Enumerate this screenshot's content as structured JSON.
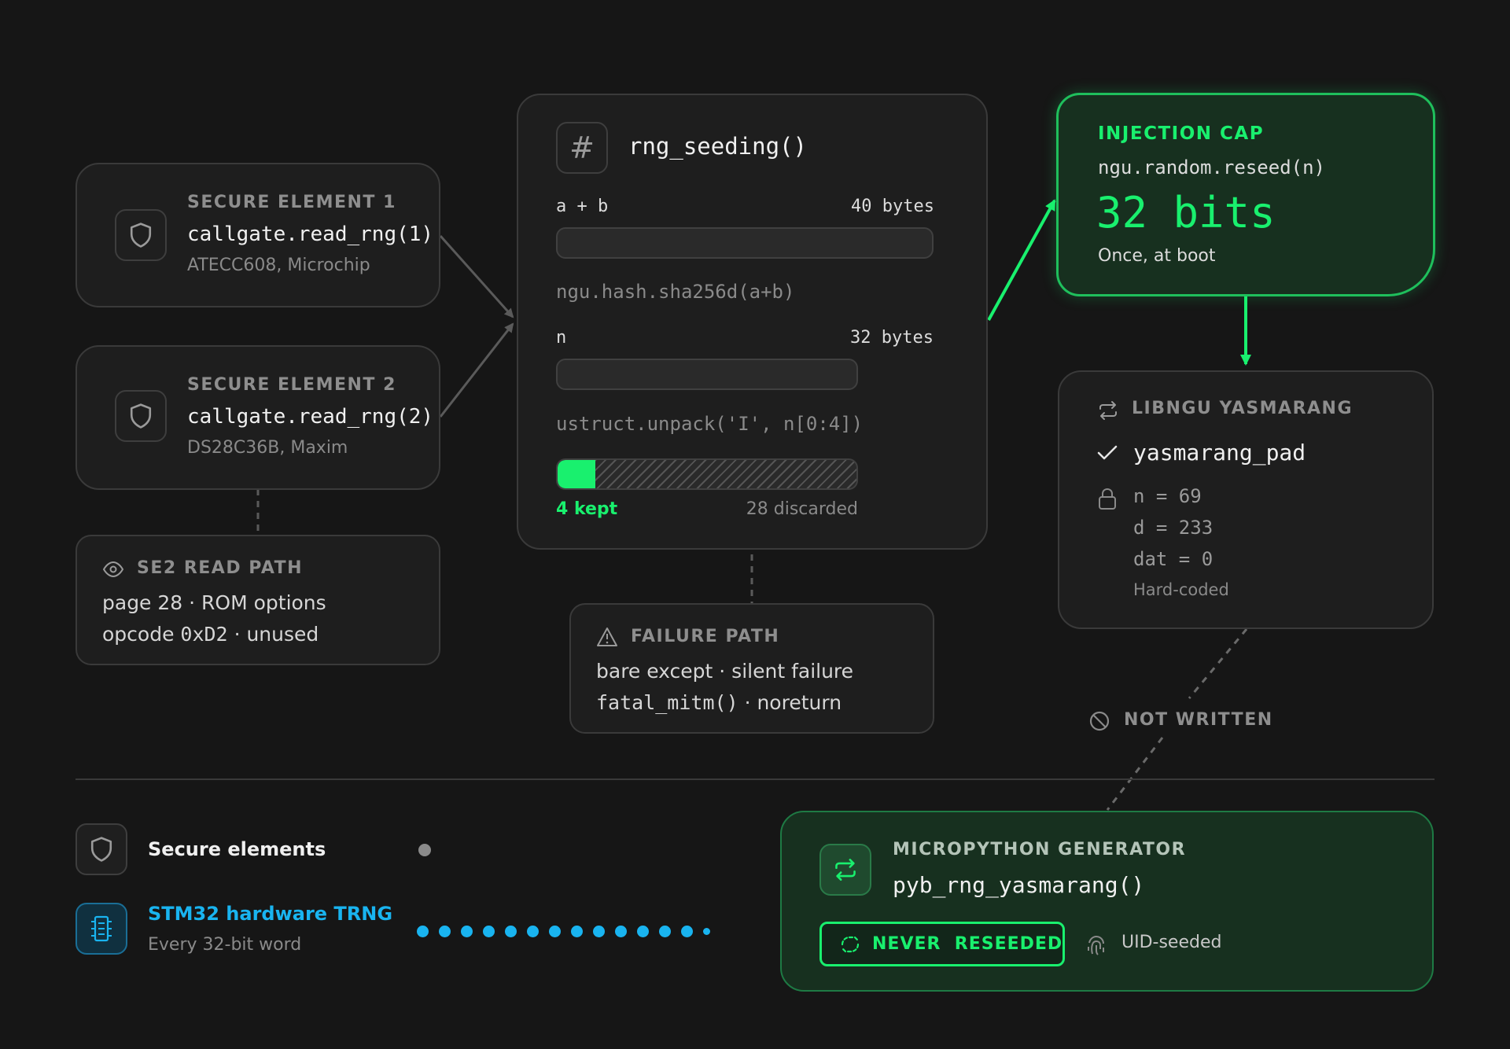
{
  "se1": {
    "label": "SECURE ELEMENT 1",
    "call": "callgate.read_rng(1)",
    "chip": "ATECC608, Microchip",
    "icon": "shield-icon"
  },
  "se2": {
    "label": "SECURE ELEMENT 2",
    "call": "callgate.read_rng(2)",
    "chip": "DS28C36B, Maxim",
    "icon": "shield-icon"
  },
  "se2_read_path": {
    "label": "SE2 READ PATH",
    "line1": "page 28 · ROM options",
    "line2_mono": "0xD2",
    "line2_pre": "opcode ",
    "line2_post": " · unused",
    "icon": "eye-icon"
  },
  "seeding": {
    "title": "rng_seeding()",
    "icon": "hash-icon",
    "ab_label": "a + b",
    "ab_size": "40 bytes",
    "hash_call": "ngu.hash.sha256d(a+b)",
    "n_label": "n",
    "n_size": "32 bytes",
    "unpack_call": "ustruct.unpack('I', n[0:4])",
    "kept": "4 kept",
    "discarded": "28 discarded",
    "kept_fraction": 0.125
  },
  "failure": {
    "label": "FAILURE PATH",
    "line1": "bare except · silent failure",
    "line2_mono": "fatal_mitm()",
    "line2_post": " · noreturn",
    "icon": "warning-icon"
  },
  "injection": {
    "label": "INJECTION CAP",
    "call": "ngu.random.reseed(n)",
    "value": "32 bits",
    "note": "Once, at boot"
  },
  "libngu": {
    "label": "LIBNGU YASMARANG",
    "icon": "repeat-icon",
    "pad": "yasmarang_pad",
    "n": "n = 69",
    "d": "d = 233",
    "dat": "dat = 0",
    "note": "Hard-coded"
  },
  "not_written": "NOT WRITTEN",
  "legend": {
    "se_label": "Secure elements",
    "trng_label": "STM32 hardware TRNG",
    "trng_sub": "Every 32-bit word"
  },
  "micropython": {
    "label": "MICROPYTHON GENERATOR",
    "call": "pyb_rng_yasmarang()",
    "badge": "NEVER  RESEEDED",
    "uid": "UID-seeded"
  },
  "colors": {
    "green": "#19f06e",
    "blue": "#19b4f0",
    "panel": "#1e1e1e",
    "green_panel": "#17301f"
  }
}
